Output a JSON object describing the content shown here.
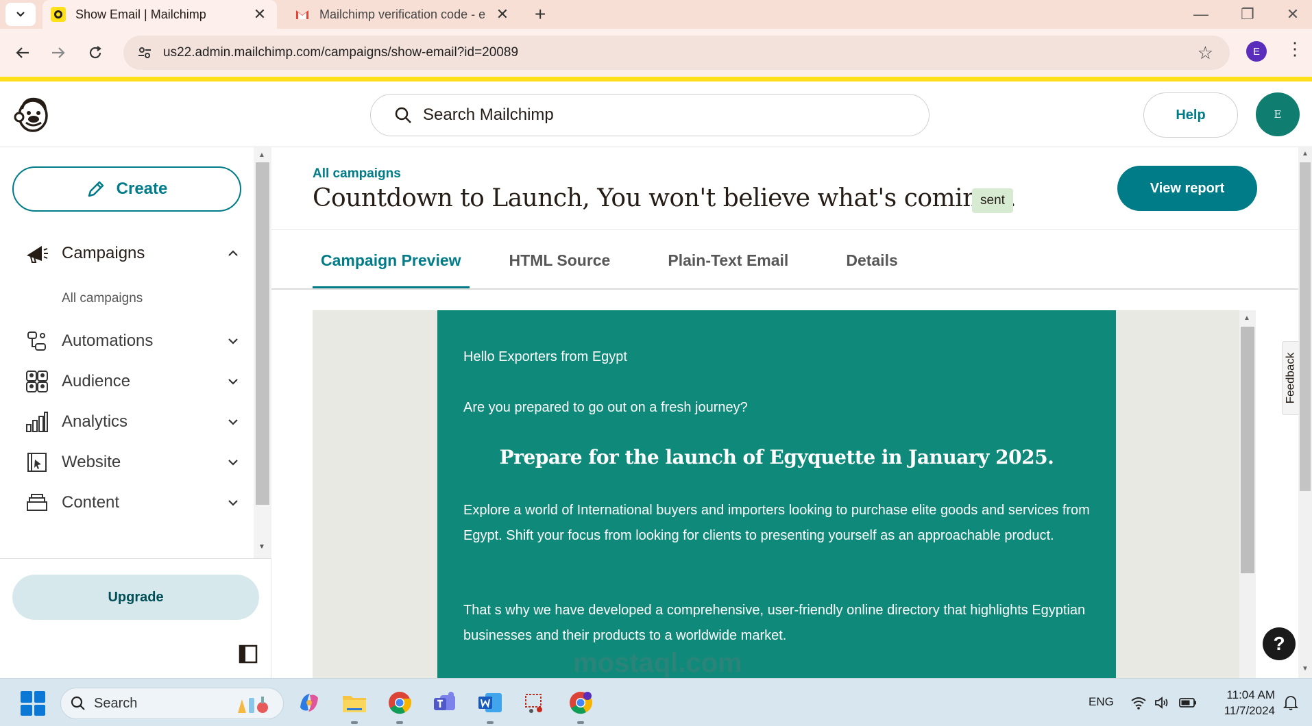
{
  "browser": {
    "tabs": [
      {
        "title": "Show Email | Mailchimp",
        "active": true,
        "icon": "mailchimp-favicon"
      },
      {
        "title": "Mailchimp verification code - e",
        "active": false,
        "icon": "gmail-favicon"
      }
    ],
    "url": "us22.admin.mailchimp.com/campaigns/show-email?id=20089",
    "profile_initial": "E",
    "window_controls": {
      "minimize": "—",
      "restore": "❐",
      "close": "✕"
    },
    "tab_close": "✕",
    "new_tab": "+"
  },
  "header": {
    "search_placeholder": "Search Mailchimp",
    "help_label": "Help",
    "account_initial": "E"
  },
  "sidebar": {
    "create_label": "Create",
    "items": [
      {
        "label": "Campaigns",
        "icon": "megaphone-icon",
        "expanded": true
      },
      {
        "label": "Automations",
        "icon": "automations-icon",
        "expanded": false
      },
      {
        "label": "Audience",
        "icon": "audience-icon",
        "expanded": false
      },
      {
        "label": "Analytics",
        "icon": "bar-chart-icon",
        "expanded": false
      },
      {
        "label": "Website",
        "icon": "website-icon",
        "expanded": false
      },
      {
        "label": "Content",
        "icon": "content-icon",
        "expanded": false
      }
    ],
    "sub_items": [
      "All campaigns"
    ],
    "upgrade_label": "Upgrade"
  },
  "main": {
    "breadcrumb": "All campaigns",
    "title": "Countdown to Launch, You won't believe what's coming...",
    "status": "sent",
    "view_report_label": "View report",
    "tabs": [
      {
        "label": "Campaign Preview",
        "selected": true
      },
      {
        "label": "HTML Source",
        "selected": false
      },
      {
        "label": "Plain-Text Email",
        "selected": false
      },
      {
        "label": "Details",
        "selected": false
      }
    ],
    "email": {
      "greeting": "Hello Exporters from Egypt",
      "question": "Are you prepared to go out on a fresh journey?",
      "headline": "Prepare for the launch of Egyquette in January 2025.",
      "paragraph1": "Explore a world of International buyers and importers looking to purchase elite goods and services from Egypt. Shift  your focus from looking for clients to presenting  yourself as an approachable product.",
      "paragraph2": "That s why we have developed a comprehensive, user-friendly online directory that highlights Egyptian businesses and their products to a worldwide market."
    },
    "feedback_label": "Feedback",
    "help_fab": "?"
  },
  "taskbar": {
    "search_label": "Search",
    "language": "ENG",
    "time": "11:04 AM",
    "date": "11/7/2024",
    "apps": [
      "copilot-icon",
      "file-explorer-icon",
      "chrome-icon",
      "teams-icon",
      "word-icon",
      "snipping-tool-icon",
      "chrome-profile-icon"
    ]
  },
  "watermark": "mostaql.com",
  "colors": {
    "brand_teal": "#007c89",
    "email_bg": "#0f8a7a",
    "accent_yellow": "#ffe01b",
    "status_sent_bg": "#d6ebd1"
  }
}
